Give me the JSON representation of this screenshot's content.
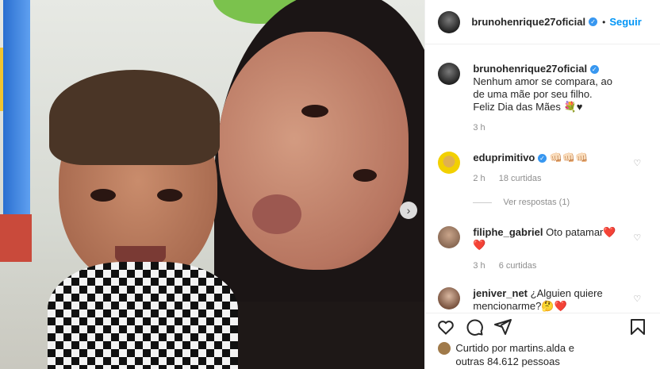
{
  "post": {
    "username": "brunohenrique27oficial",
    "follow_label": "Seguir",
    "separator": "•"
  },
  "caption": {
    "username": "brunohenrique27oficial",
    "text": "Nenhum amor se compara, ao de uma mãe por seu filho.",
    "line2": "Feliz Dia das Mães 💐♥",
    "time": "3 h"
  },
  "comments": [
    {
      "username": "eduprimitivo",
      "verified": true,
      "text": "👊🏻👊🏻👊🏻",
      "time": "2 h",
      "likes": "18 curtidas"
    },
    {
      "username": "filiphe_gabriel",
      "verified": false,
      "text": "Oto patamar❤️❤️",
      "time": "3 h",
      "likes": "6 curtidas"
    },
    {
      "username": "jeniver_net",
      "verified": false,
      "text": "¿Alguien quiere mencionarme?🤔❤️",
      "time": "",
      "likes": ""
    }
  ],
  "view_replies": "Ver respostas (1)",
  "liked_by": {
    "prefix": "Curtido por",
    "user": "martins.alda",
    "suffix_prefix": "e",
    "others": "outras 84.612 pessoas"
  },
  "icons": {
    "like": "heart-icon",
    "comment": "comment-icon",
    "share": "share-icon",
    "save": "bookmark-icon",
    "next": "chevron-right-icon"
  }
}
